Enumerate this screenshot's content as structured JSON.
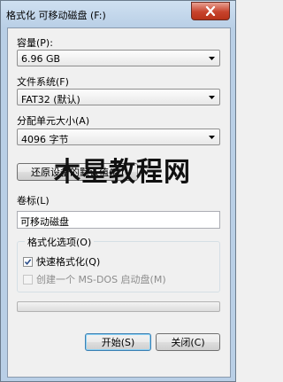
{
  "window": {
    "title": "格式化 可移动磁盘 (F:)"
  },
  "capacity": {
    "label": "容量(P):",
    "value": "6.96 GB"
  },
  "filesystem": {
    "label": "文件系统(F)",
    "value": "FAT32 (默认)"
  },
  "allocation": {
    "label": "分配单元大小(A)",
    "value": "4096 字节"
  },
  "restore_defaults_label": "还原设备的默认值(D)",
  "volume": {
    "label": "卷标(L)",
    "value": "可移动磁盘"
  },
  "format_options": {
    "title": "格式化选项(O)",
    "quick_format": {
      "label": "快速格式化(Q)",
      "checked": true
    },
    "msdos_disk": {
      "label": "创建一个 MS-DOS 启动盘(M)",
      "checked": false,
      "enabled": false
    }
  },
  "progress": {
    "value": 0
  },
  "buttons": {
    "start": "开始(S)",
    "close": "关闭(C)"
  },
  "watermark": "木星教程网",
  "icons": {
    "close": "close-icon",
    "dropdown": "chevron-down-icon",
    "check": "checkmark-icon"
  }
}
